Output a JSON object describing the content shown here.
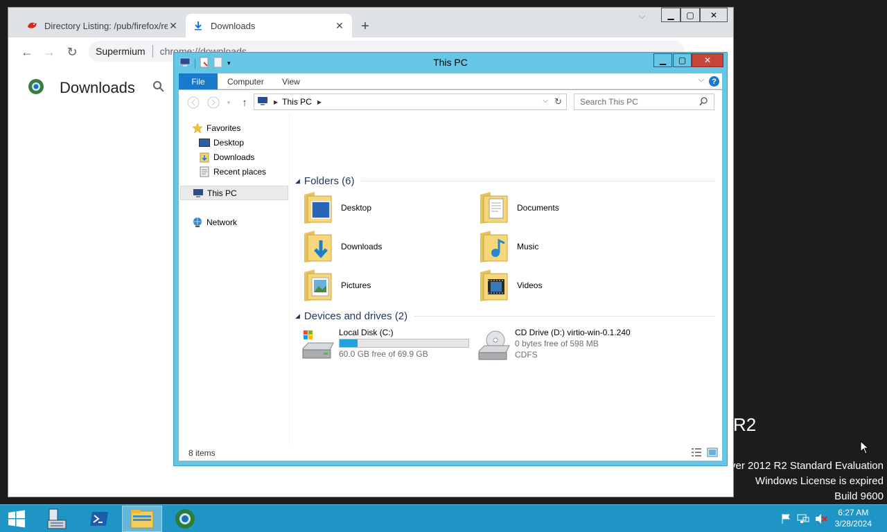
{
  "desktop": {
    "watermark_r2": "R2",
    "watermark_line1": "ver 2012 R2 Standard Evaluation",
    "watermark_line2": "Windows License is expired",
    "watermark_line3": "Build 9600"
  },
  "browser": {
    "tabs": [
      {
        "title": "Directory Listing: /pub/firefox/re",
        "icon": "red-dinosaur-icon"
      },
      {
        "title": "Downloads",
        "icon": "download-icon"
      }
    ],
    "new_tab_label": "+",
    "omnibox": {
      "site_label": "Supermium",
      "url": "chrome://downloads"
    },
    "page_title": "Downloads"
  },
  "explorer": {
    "title": "This PC",
    "ribbon_tabs": [
      "File",
      "Computer",
      "View"
    ],
    "address_segment": "This PC",
    "search_placeholder": "Search This PC",
    "nav": {
      "favorites": "Favorites",
      "desktop": "Desktop",
      "downloads": "Downloads",
      "recent": "Recent places",
      "this_pc": "This PC",
      "network": "Network"
    },
    "folders_group": "Folders (6)",
    "folders": [
      "Desktop",
      "Documents",
      "Downloads",
      "Music",
      "Pictures",
      "Videos"
    ],
    "devices_group": "Devices and drives (2)",
    "drives": [
      {
        "name": "Local Disk (C:)",
        "free_text": "60.0 GB free of 69.9 GB",
        "used_fraction": 0.14
      },
      {
        "name": "CD Drive (D:) virtio-win-0.1.240",
        "free_text": "0 bytes free of 598 MB",
        "fs": "CDFS"
      }
    ],
    "status": "8 items"
  },
  "taskbar": {
    "time": "6:27 AM",
    "date": "3/28/2024"
  },
  "colors": {
    "explorer_frame": "#66c6e6",
    "taskbar": "#1e95c4",
    "ribbon_file": "#1979ca",
    "close_button": "#c7463a"
  }
}
